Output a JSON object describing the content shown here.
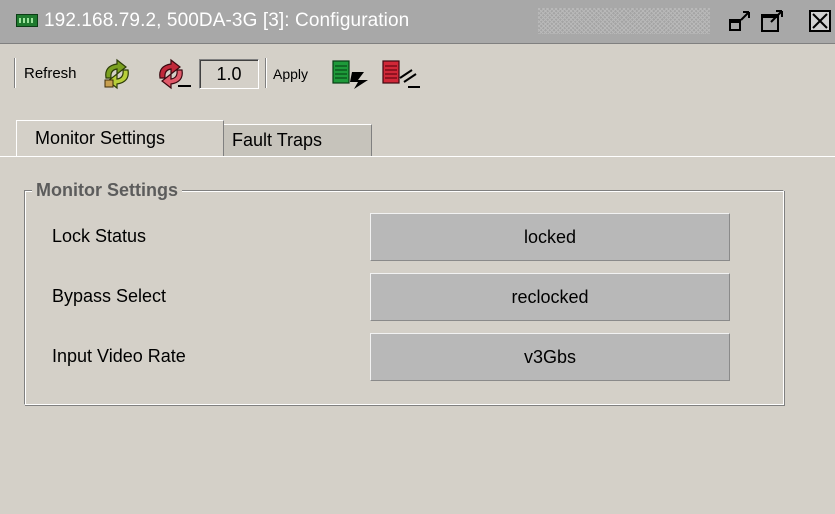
{
  "window": {
    "title": "192.168.79.2, 500DA-3G  [3]: Configuration",
    "buttons": [
      "undock-icon",
      "maximize-icon",
      "close-icon"
    ]
  },
  "toolbar": {
    "refresh_label": "Refresh",
    "zoom_value": "1.0",
    "apply_label": "Apply",
    "icons": [
      "refresh-green-icon",
      "refresh-red-icon",
      "apply-green-icon",
      "apply-red-icon"
    ]
  },
  "tabs": [
    {
      "label": "Monitor Settings",
      "active": true
    },
    {
      "label": "Fault Traps",
      "active": false
    }
  ],
  "monitor_settings": {
    "group_title": "Monitor Settings",
    "rows": [
      {
        "label": "Lock Status",
        "value": "locked"
      },
      {
        "label": "Bypass Select",
        "value": "reclocked"
      },
      {
        "label": "Input Video Rate",
        "value": "v3Gbs"
      }
    ]
  },
  "colors": {
    "titlebar": "#a8a8a8",
    "background": "#d4d0c8",
    "value_box": "#b8b8b8",
    "group_title": "#5c5c5c"
  }
}
